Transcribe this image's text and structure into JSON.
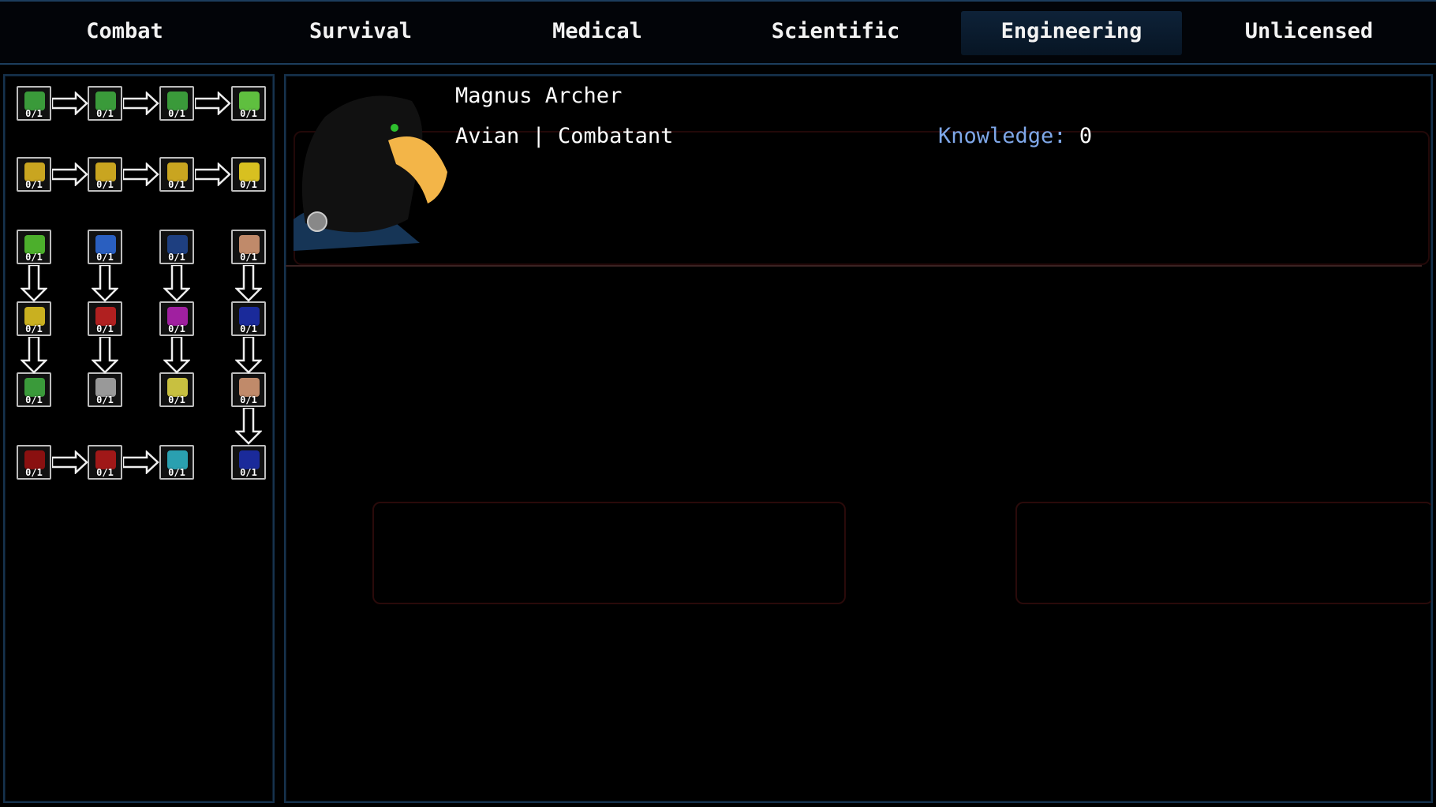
{
  "tabs": [
    {
      "label": "Combat",
      "active": false
    },
    {
      "label": "Survival",
      "active": false
    },
    {
      "label": "Medical",
      "active": false
    },
    {
      "label": "Scientific",
      "active": false
    },
    {
      "label": "Engineering",
      "active": true
    },
    {
      "label": "Unlicensed",
      "active": false
    }
  ],
  "character": {
    "name": "Magnus Archer",
    "subtitle": "Avian | Combatant",
    "knowledge_label": "Knowledge:",
    "knowledge_value": "0"
  },
  "skills": [
    {
      "icon": "battery-transfer-icon",
      "count": "0/1",
      "color": "#3a9a3a"
    },
    {
      "icon": "battery-transfer-charge-icon",
      "count": "0/1",
      "color": "#3a9a3a"
    },
    {
      "icon": "battery-swap-icon",
      "count": "0/1",
      "color": "#3a9a3a"
    },
    {
      "icon": "battery-plus-icon",
      "count": "0/1",
      "color": "#5fbf3f"
    },
    {
      "icon": "charge-transfer-icon",
      "count": "0/1",
      "color": "#c9a520"
    },
    {
      "icon": "charge-transfer-battery-icon",
      "count": "0/1",
      "color": "#c9a520"
    },
    {
      "icon": "charge-swap-icon",
      "count": "0/1",
      "color": "#c9a520"
    },
    {
      "icon": "battery-lightning-icon",
      "count": "0/1",
      "color": "#d8c020"
    },
    {
      "icon": "battery-recharge-icon",
      "count": "0/1",
      "color": "#4caf2c"
    },
    {
      "icon": "globe-icon",
      "count": "0/1",
      "color": "#2a5fc0"
    },
    {
      "icon": "shield-bubble-icon",
      "count": "0/1",
      "color": "#1e3f80"
    },
    {
      "icon": "bandage-icon",
      "count": "0/1",
      "color": "#c08a6a"
    },
    {
      "icon": "battery-warning-icon",
      "count": "0/1",
      "color": "#c9b020"
    },
    {
      "icon": "globe-hazard-icon",
      "count": "0/1",
      "color": "#b02020"
    },
    {
      "icon": "purple-bubble-icon",
      "count": "0/1",
      "color": "#a020a0"
    },
    {
      "icon": "power-pack-icon",
      "count": "0/1",
      "color": "#1a2a9a"
    },
    {
      "icon": "battery-plug-icon",
      "count": "0/1",
      "color": "#3a9a3a"
    },
    {
      "icon": "shock-hand-icon",
      "count": "0/1",
      "color": "#999"
    },
    {
      "icon": "glow-figure-icon",
      "count": "0/1",
      "color": "#c8c040"
    },
    {
      "icon": "bandage-icon",
      "count": "0/1",
      "color": "#c08a6a"
    },
    {
      "icon": "skull-face-icon",
      "count": "0/1",
      "color": "#8a1010"
    },
    {
      "icon": "red-figure-icon",
      "count": "0/1",
      "color": "#a01818"
    },
    {
      "icon": "eye-icon",
      "count": "0/1",
      "color": "#2aa0b0"
    },
    {
      "icon": "power-pack-icon",
      "count": "0/1",
      "color": "#1a2a9a"
    }
  ]
}
